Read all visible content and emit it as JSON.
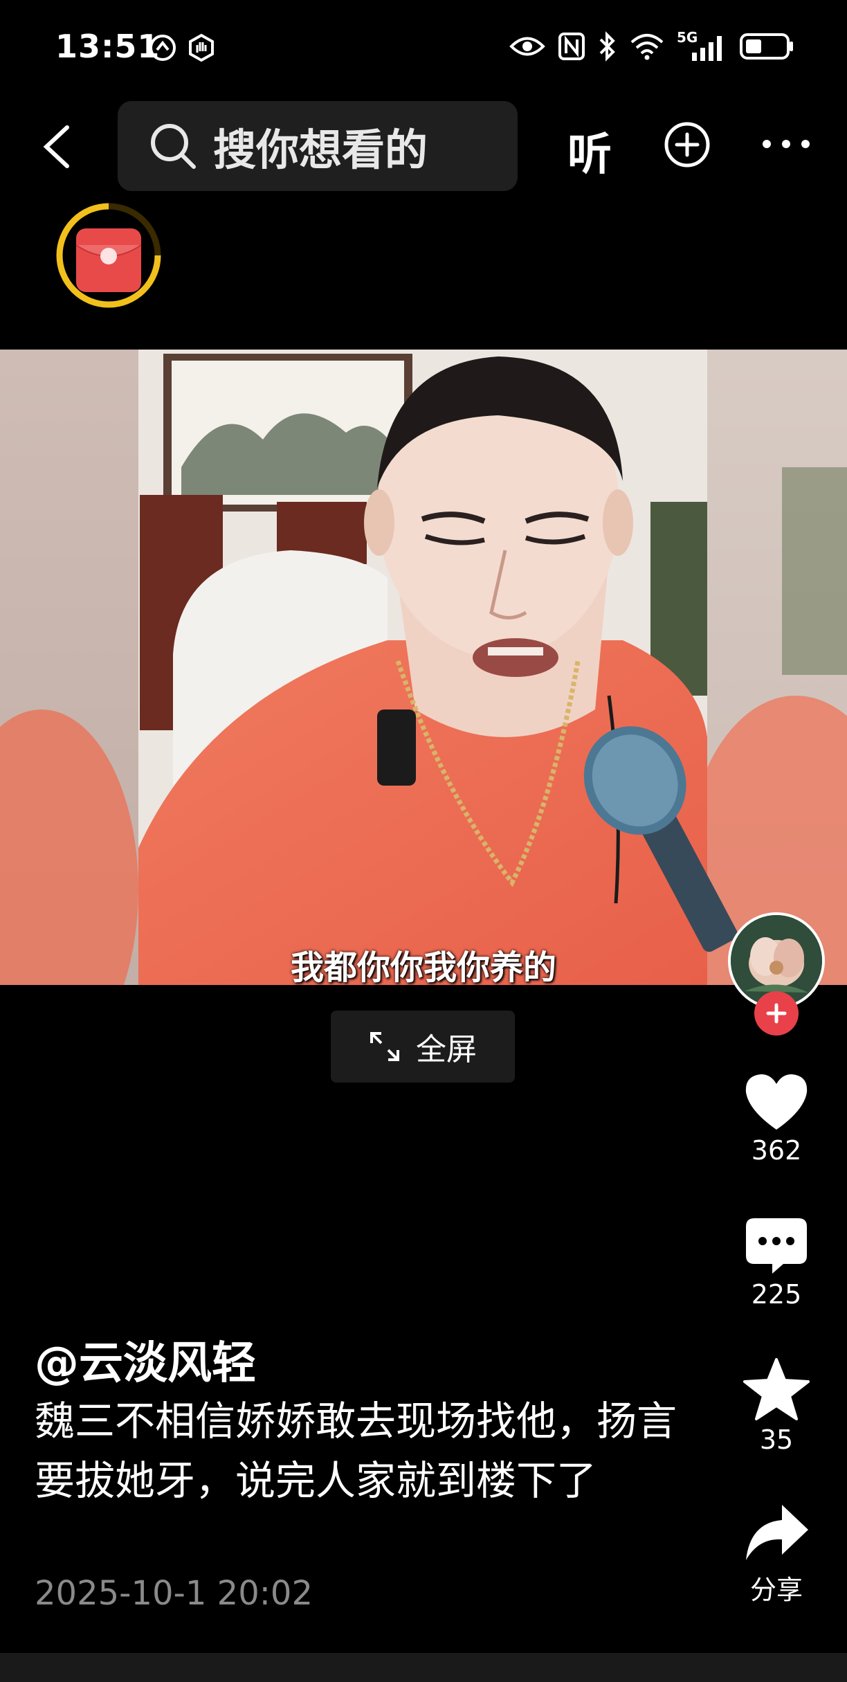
{
  "status_bar": {
    "time": "13:51",
    "left_icons": [
      "speed-badge-icon",
      "hand-badge-icon"
    ],
    "right_icons": [
      "eye-icon",
      "nfc-icon",
      "bluetooth-icon",
      "wifi-icon",
      "5g-signal-icon",
      "battery-icon"
    ],
    "network_label": "5G"
  },
  "header": {
    "search_placeholder": "搜你想看的",
    "listen_label": "听"
  },
  "video": {
    "subtitle": "我都你你我你养的",
    "fullscreen_label": "全屏"
  },
  "actions": {
    "like_count": "362",
    "comment_count": "225",
    "favorite_count": "35",
    "share_label": "分享"
  },
  "post": {
    "author": "@云淡风轻",
    "caption": "魏三不相信娇娇敢去现场找他，扬言要拔她牙，说完人家就到楼下了",
    "date": "2025-10-1 20:02"
  },
  "colors": {
    "background": "#000000",
    "follow_red": "#e8414a",
    "red_packet": "#e84a4a",
    "red_packet_ring": "#f2c01c",
    "timestamp_gray": "#8a8a8a"
  }
}
